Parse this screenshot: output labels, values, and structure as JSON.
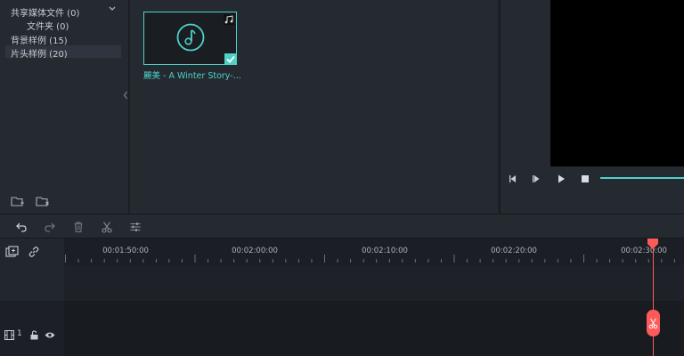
{
  "library_sidebar": {
    "categories": [
      {
        "label": "共享媒体文件 (0)"
      },
      {
        "label": "文件夹 (0)"
      },
      {
        "label": "背景样例 (15)"
      },
      {
        "label": "片头样例 (20)"
      }
    ],
    "selected": "片头样例 (20)"
  },
  "media": {
    "items": [
      {
        "title": "麗美 - A Winter Story-...",
        "type_icon": "music-note-icon",
        "selected": true
      }
    ]
  },
  "timeline": {
    "ruler": [
      "00:01:50:00",
      "00:02:00:00",
      "00:02:10:00",
      "00:02:20:00",
      "00:02:30:00"
    ],
    "track_number": "1"
  },
  "colors": {
    "accent": "#4fd1c5",
    "playhead": "#ff5a5a",
    "panel": "#252a31",
    "timeline_bg": "#181b20"
  }
}
